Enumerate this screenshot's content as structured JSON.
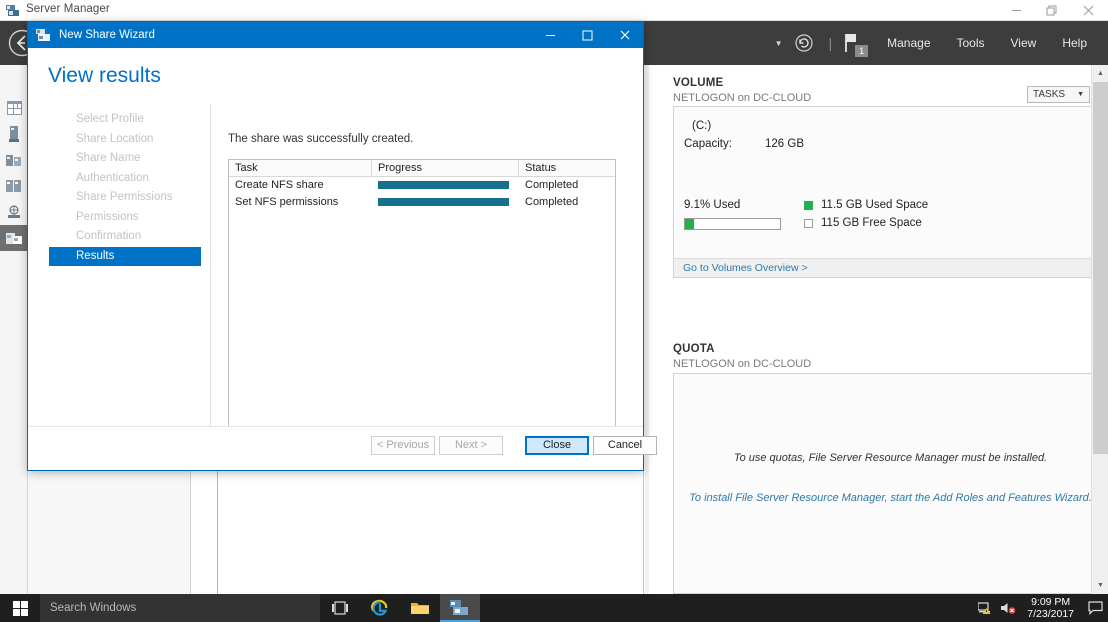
{
  "server_manager": {
    "title": "Server Manager",
    "title_icon": "server-manager-icon",
    "window_buttons": {
      "minimize": "minimize-icon",
      "restore": "restore-icon",
      "close": "close-icon"
    },
    "back_icon": "back-arrow-icon",
    "menu": {
      "caret": "chevron-down-icon",
      "refresh_icon": "refresh-icon",
      "divider": "|",
      "flag_icon": "notification-flag-icon",
      "flag_badge": "1",
      "items": [
        {
          "label": "Manage"
        },
        {
          "label": "Tools"
        },
        {
          "label": "View"
        },
        {
          "label": "Help"
        }
      ]
    },
    "rail_items": [
      {
        "name": "dashboard-icon"
      },
      {
        "name": "local-server-icon"
      },
      {
        "name": "all-servers-icon"
      },
      {
        "name": "ad-ds-icon"
      },
      {
        "name": "dns-icon"
      },
      {
        "name": "file-and-storage-services-icon"
      }
    ],
    "volume": {
      "section_title": "VOLUME",
      "section_subtitle": "NETLOGON on DC-CLOUD",
      "tasks_label": "TASKS",
      "tasks_caret": "chevron-down-icon",
      "drive_name": "(C:)",
      "capacity_label": "Capacity:",
      "capacity_value": "126 GB",
      "percent_used_label": "9.1% Used",
      "percent_used": 9.1,
      "legend": [
        {
          "label": "11.5 GB Used Space",
          "swatch": "used",
          "color": "#22b14c"
        },
        {
          "label": "115 GB Free Space",
          "swatch": "free",
          "color": "#ffffff"
        }
      ],
      "footer_link": "Go to Volumes Overview >"
    },
    "quota": {
      "section_title": "QUOTA",
      "section_subtitle": "NETLOGON on DC-CLOUD",
      "line1": "To use quotas, File Server Resource Manager must be installed.",
      "line2": "To install File Server Resource Manager, start the Add Roles and Features Wizard."
    },
    "scrollbar": {
      "up": "scroll-up-arrow-icon",
      "down": "scroll-down-arrow-icon"
    }
  },
  "wizard": {
    "title": "New Share Wizard",
    "title_icon": "share-wizard-icon",
    "window_buttons": {
      "minimize": "minimize-icon",
      "maximize": "maximize-icon",
      "close": "close-icon"
    },
    "heading": "View results",
    "steps": [
      {
        "label": "Select Profile",
        "active": false
      },
      {
        "label": "Share Location",
        "active": false
      },
      {
        "label": "Share Name",
        "active": false
      },
      {
        "label": "Authentication",
        "active": false
      },
      {
        "label": "Share Permissions",
        "active": false
      },
      {
        "label": "Permissions",
        "active": false
      },
      {
        "label": "Confirmation",
        "active": false
      },
      {
        "label": "Results",
        "active": true
      }
    ],
    "message": "The share was successfully created.",
    "table": {
      "columns": [
        "Task",
        "Progress",
        "Status"
      ],
      "rows": [
        {
          "task": "Create NFS share",
          "progress": 100,
          "status": "Completed"
        },
        {
          "task": "Set NFS permissions",
          "progress": 100,
          "status": "Completed"
        }
      ]
    },
    "buttons": [
      {
        "label": "< Previous",
        "state": "disabled"
      },
      {
        "label": "Next >",
        "state": "disabled"
      },
      {
        "label": "Close",
        "state": "default"
      },
      {
        "label": "Cancel",
        "state": "normal"
      }
    ],
    "accent_color": "#0072c6",
    "progress_color": "#17708f"
  },
  "taskbar": {
    "start_icon": "windows-start-icon",
    "search_placeholder": "Search Windows",
    "buttons": [
      {
        "name": "task-view-icon"
      },
      {
        "name": "internet-explorer-icon"
      },
      {
        "name": "file-explorer-icon"
      },
      {
        "name": "server-manager-taskbar-icon",
        "active": true
      }
    ],
    "tray": {
      "network_icon": "network-warning-icon",
      "volume_icon": "volume-muted-icon",
      "time": "9:09 PM",
      "date": "7/23/2017",
      "action_center_icon": "action-center-icon"
    }
  }
}
